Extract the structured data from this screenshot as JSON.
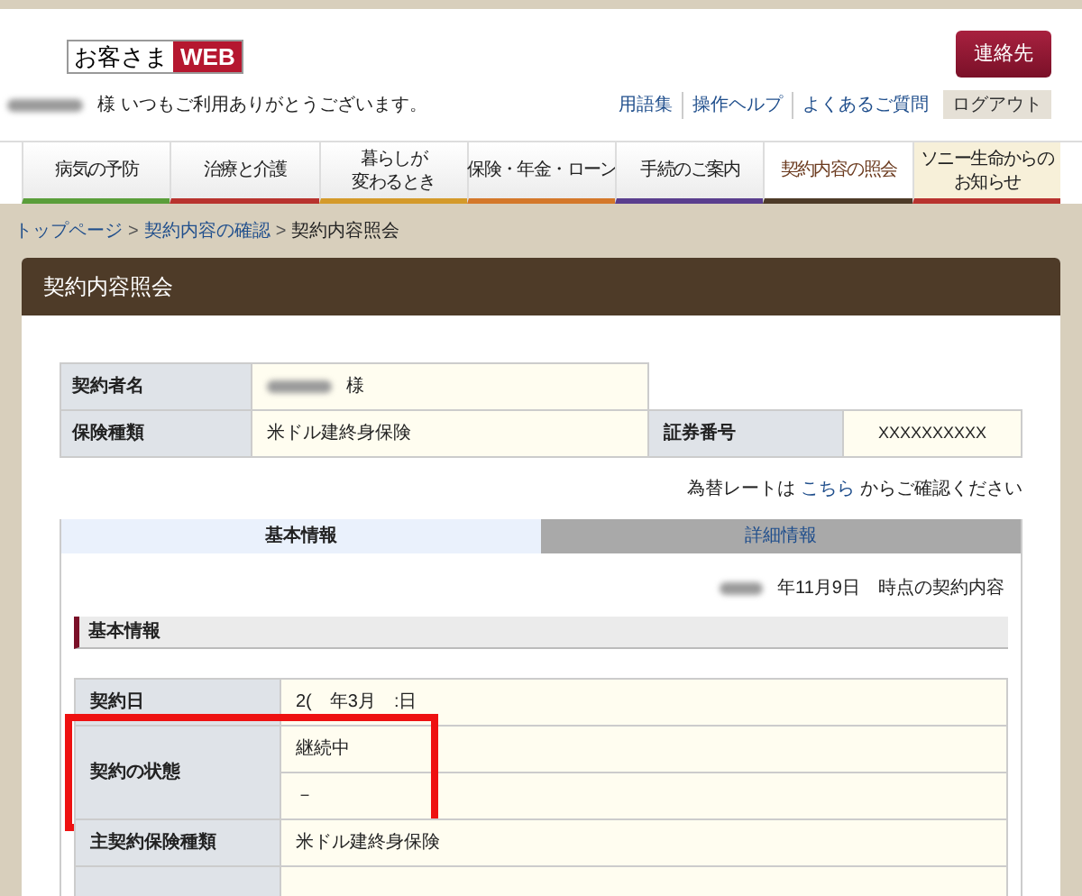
{
  "header": {
    "logo": {
      "text": "お客さま",
      "badge": "WEB"
    },
    "contact_button": "連絡先",
    "greeting": "様 いつもご利用ありがとうございます。",
    "links": [
      "用語集",
      "操作ヘルプ",
      "よくあるご質問"
    ],
    "logout_button": "ログアウト"
  },
  "nav": [
    {
      "lines": [
        "病気の予防"
      ],
      "selected": false,
      "kind": "menu",
      "color": "#5a9e3a"
    },
    {
      "lines": [
        "治療と介護"
      ],
      "selected": false,
      "kind": "menu",
      "color": "#b8332e"
    },
    {
      "lines": [
        "暮らしが",
        "変わるとき"
      ],
      "selected": false,
      "kind": "menu",
      "color": "#d49a2a"
    },
    {
      "lines": [
        "保険・年金・ローン"
      ],
      "selected": false,
      "kind": "menu",
      "color": "#d4782a"
    },
    {
      "lines": [
        "手続のご案内"
      ],
      "selected": false,
      "kind": "menu",
      "color": "#5a3e8e"
    },
    {
      "lines": [
        "契約内容の照会"
      ],
      "selected": true,
      "kind": "menu",
      "color": "#4e3b28"
    },
    {
      "lines": [
        "ソニー生命からの",
        "お知らせ"
      ],
      "selected": false,
      "kind": "notice",
      "color": "#b8332e"
    }
  ],
  "breadcrumb": [
    {
      "label": "トップページ",
      "kind": "link"
    },
    {
      "label": ">",
      "kind": "separator"
    },
    {
      "label": "契約内容の確認",
      "kind": "link"
    },
    {
      "label": ">",
      "kind": "separator"
    },
    {
      "label": "契約内容照会",
      "kind": "current"
    }
  ],
  "card_title": "契約内容照会",
  "summary": [
    {
      "label": "契約者名",
      "value": "様",
      "redacted": true
    },
    {
      "label": "保険種類",
      "value": "米ドル建終身保険",
      "redacted": false,
      "extra_label": "証券番号",
      "extra_value": "XXXXXXXXXX"
    }
  ],
  "rate_note": {
    "before": "為替レートは",
    "link": "こちら",
    "after": "からご確認ください"
  },
  "tabs": [
    {
      "label": "基本情報",
      "selected": true
    },
    {
      "label": "詳細情報",
      "selected": false
    }
  ],
  "as_of": "年11月9日　時点の契約内容",
  "section_title": "基本情報",
  "details": [
    {
      "label": "契約日",
      "values": [
        "2(　年3月　:日"
      ],
      "highlighted": false
    },
    {
      "label": "契約の状態",
      "values": [
        "継続中",
        "－"
      ],
      "highlighted": true
    },
    {
      "label": "主契約保険種類",
      "values": [
        "米ドル建終身保険"
      ],
      "highlighted": false
    }
  ]
}
